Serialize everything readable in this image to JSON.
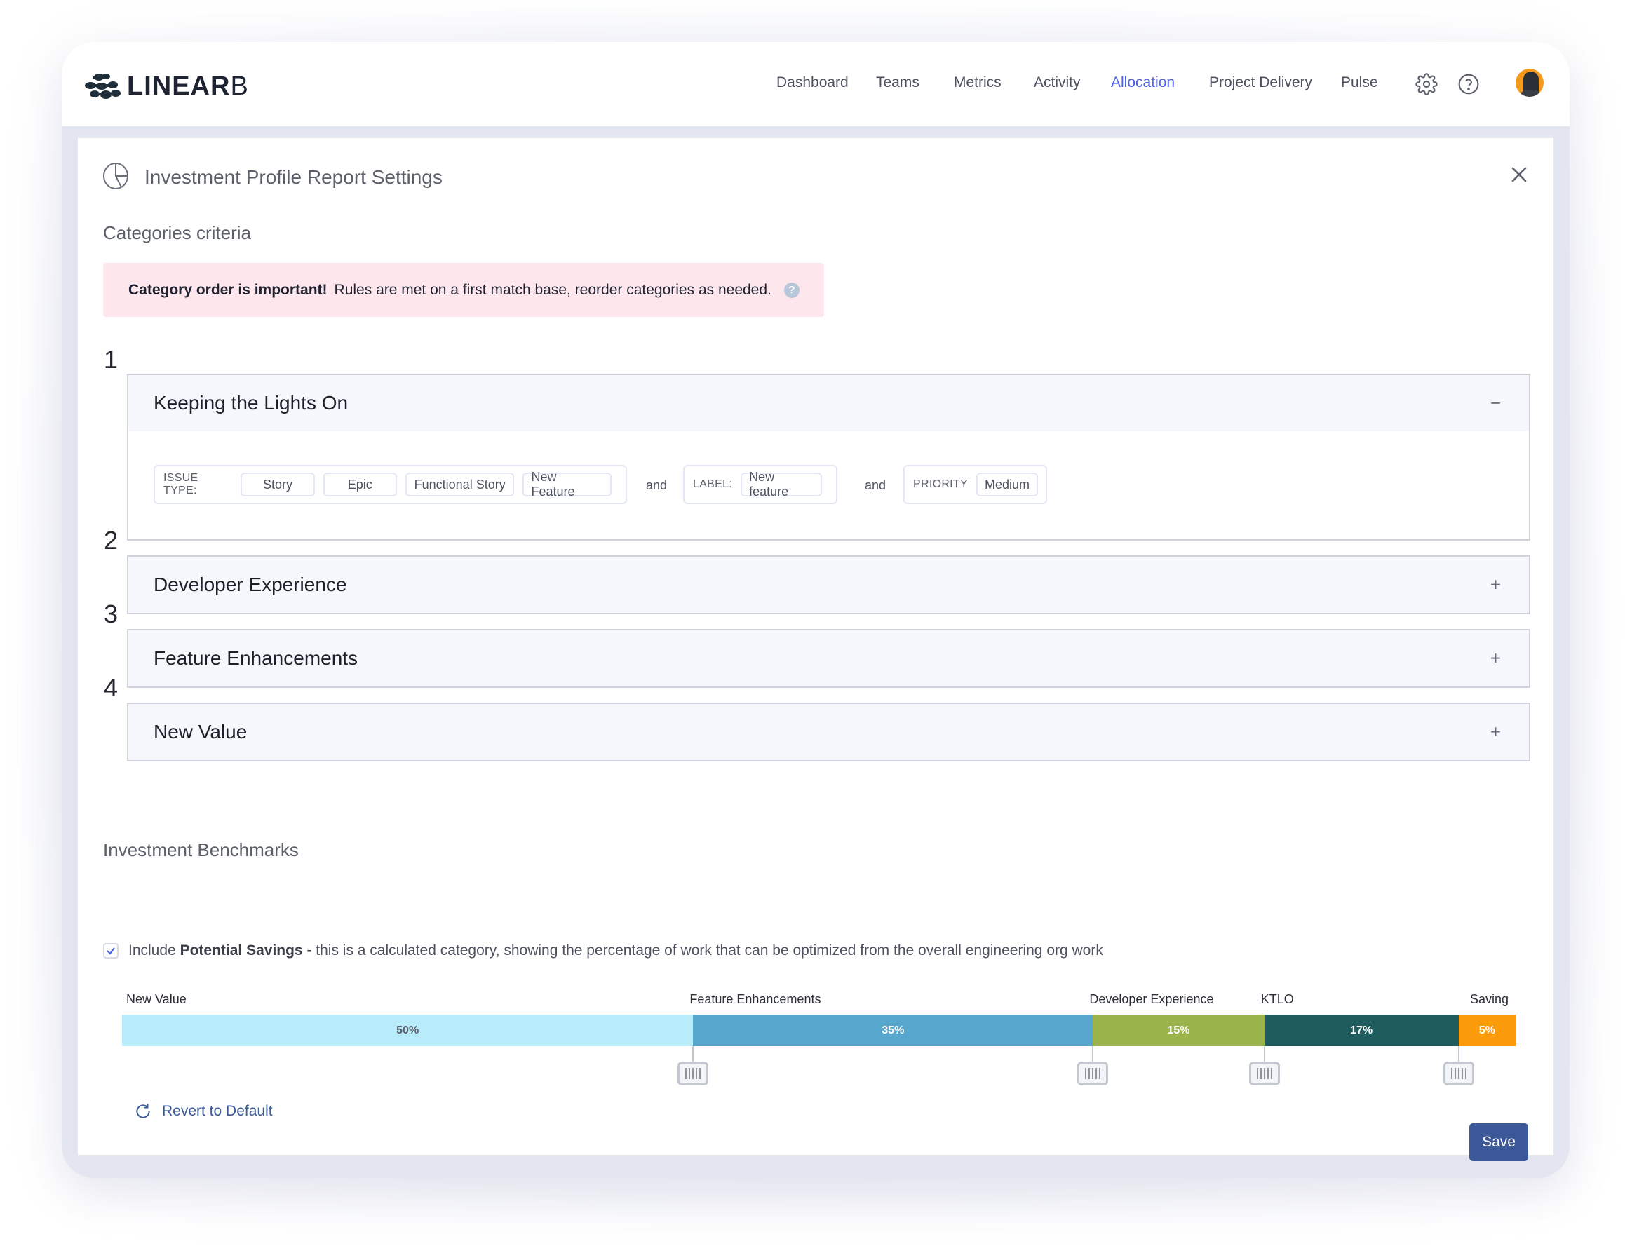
{
  "app": {
    "brand_bold": "LINEAR",
    "brand_light": "B"
  },
  "nav": {
    "items": [
      {
        "label": "Dashboard",
        "active": false
      },
      {
        "label": "Teams",
        "active": false
      },
      {
        "label": "Metrics",
        "active": false
      },
      {
        "label": "Activity",
        "active": false
      },
      {
        "label": "Allocation",
        "active": true
      },
      {
        "label": "Project Delivery",
        "active": false
      },
      {
        "label": "Pulse",
        "active": false
      }
    ],
    "icons": [
      "gear-icon",
      "help-icon",
      "user-avatar"
    ],
    "active_color": "#4b61e8"
  },
  "dialog": {
    "title": "Investment Profile Report Settings",
    "icon": "pie-chart-icon",
    "close_icon": "close-icon"
  },
  "criteria": {
    "section_title": "Categories criteria",
    "warning_bold": "Category order is important!",
    "warning_text": "Rules are met on a first match base, reorder categories as needed.",
    "warning_help": "?",
    "categories": [
      {
        "number": "1",
        "name": "Keeping the Lights On",
        "expanded": true,
        "toggle": "−",
        "rules": [
          {
            "label": "ISSUE TYPE:",
            "values": [
              "Story",
              "Epic",
              "Functional Story",
              "New Feature"
            ]
          },
          {
            "label": "LABEL:",
            "values": [
              "New feature"
            ]
          },
          {
            "label": "PRIORITY",
            "values": [
              "Medium"
            ]
          }
        ],
        "connector": "and"
      },
      {
        "number": "2",
        "name": "Developer Experience",
        "expanded": false,
        "toggle": "+"
      },
      {
        "number": "3",
        "name": "Feature Enhancements",
        "expanded": false,
        "toggle": "+"
      },
      {
        "number": "4",
        "name": "New Value",
        "expanded": false,
        "toggle": "+"
      }
    ]
  },
  "benchmarks": {
    "section_title": "Investment Benchmarks",
    "include_savings_checked": true,
    "include_prefix": "Include",
    "include_bold": "Potential Savings -",
    "include_text": "this is a calculated category, showing the percentage of work that can be optimized from the overall engineering org work",
    "segments": [
      {
        "label": "New Value",
        "percent": 50,
        "display": "50%",
        "color": "#b9ecfb",
        "text_color": "#5a5f6a"
      },
      {
        "label": "Feature Enhancements",
        "percent": 35,
        "display": "35%",
        "color": "#57a6cd",
        "text_color": "#ffffff"
      },
      {
        "label": "Developer Experience",
        "percent": 15,
        "display": "15%",
        "color": "#9bb34b",
        "text_color": "#ffffff"
      },
      {
        "label": "KTLO",
        "percent": 17,
        "display": "17%",
        "color": "#1f5c5d",
        "text_color": "#ffffff"
      },
      {
        "label": "Saving",
        "percent": 5,
        "display": "5%",
        "color": "#fb9b0c",
        "text_color": "#ffffff"
      }
    ],
    "revert_label": "Revert to Default",
    "save_label": "Save"
  }
}
